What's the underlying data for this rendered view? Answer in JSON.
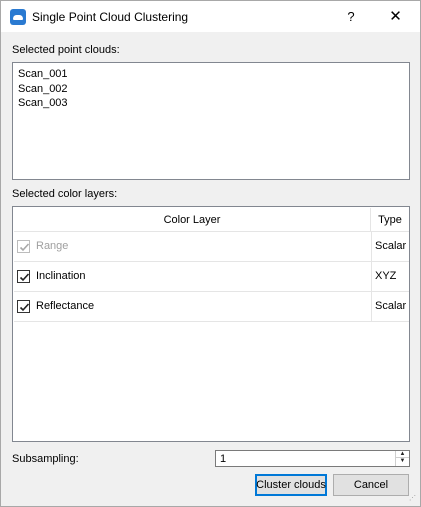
{
  "window": {
    "title": "Single Point Cloud Clustering",
    "help_label": "?",
    "close_label": "✕"
  },
  "clouds": {
    "label": "Selected point clouds:",
    "items": [
      "Scan_001",
      "Scan_002",
      "Scan_003"
    ]
  },
  "layers": {
    "label": "Selected color layers:",
    "header": {
      "color_layer": "Color Layer",
      "type": "Type"
    },
    "rows": [
      {
        "name": "Range",
        "type": "Scalar",
        "checked": true,
        "enabled": false
      },
      {
        "name": "Inclination",
        "type": "XYZ",
        "checked": true,
        "enabled": true
      },
      {
        "name": "Reflectance",
        "type": "Scalar",
        "checked": true,
        "enabled": true
      }
    ]
  },
  "subsampling": {
    "label": "Subsampling:",
    "value": "1"
  },
  "buttons": {
    "cluster": "Cluster clouds",
    "cancel": "Cancel"
  },
  "colors": {
    "accent": "#0078d7",
    "icon": "#2a7ad1"
  },
  "icons": {
    "app": "cloud-icon",
    "close": "close-icon",
    "help": "help-icon",
    "resize": "resize-grip-icon"
  }
}
